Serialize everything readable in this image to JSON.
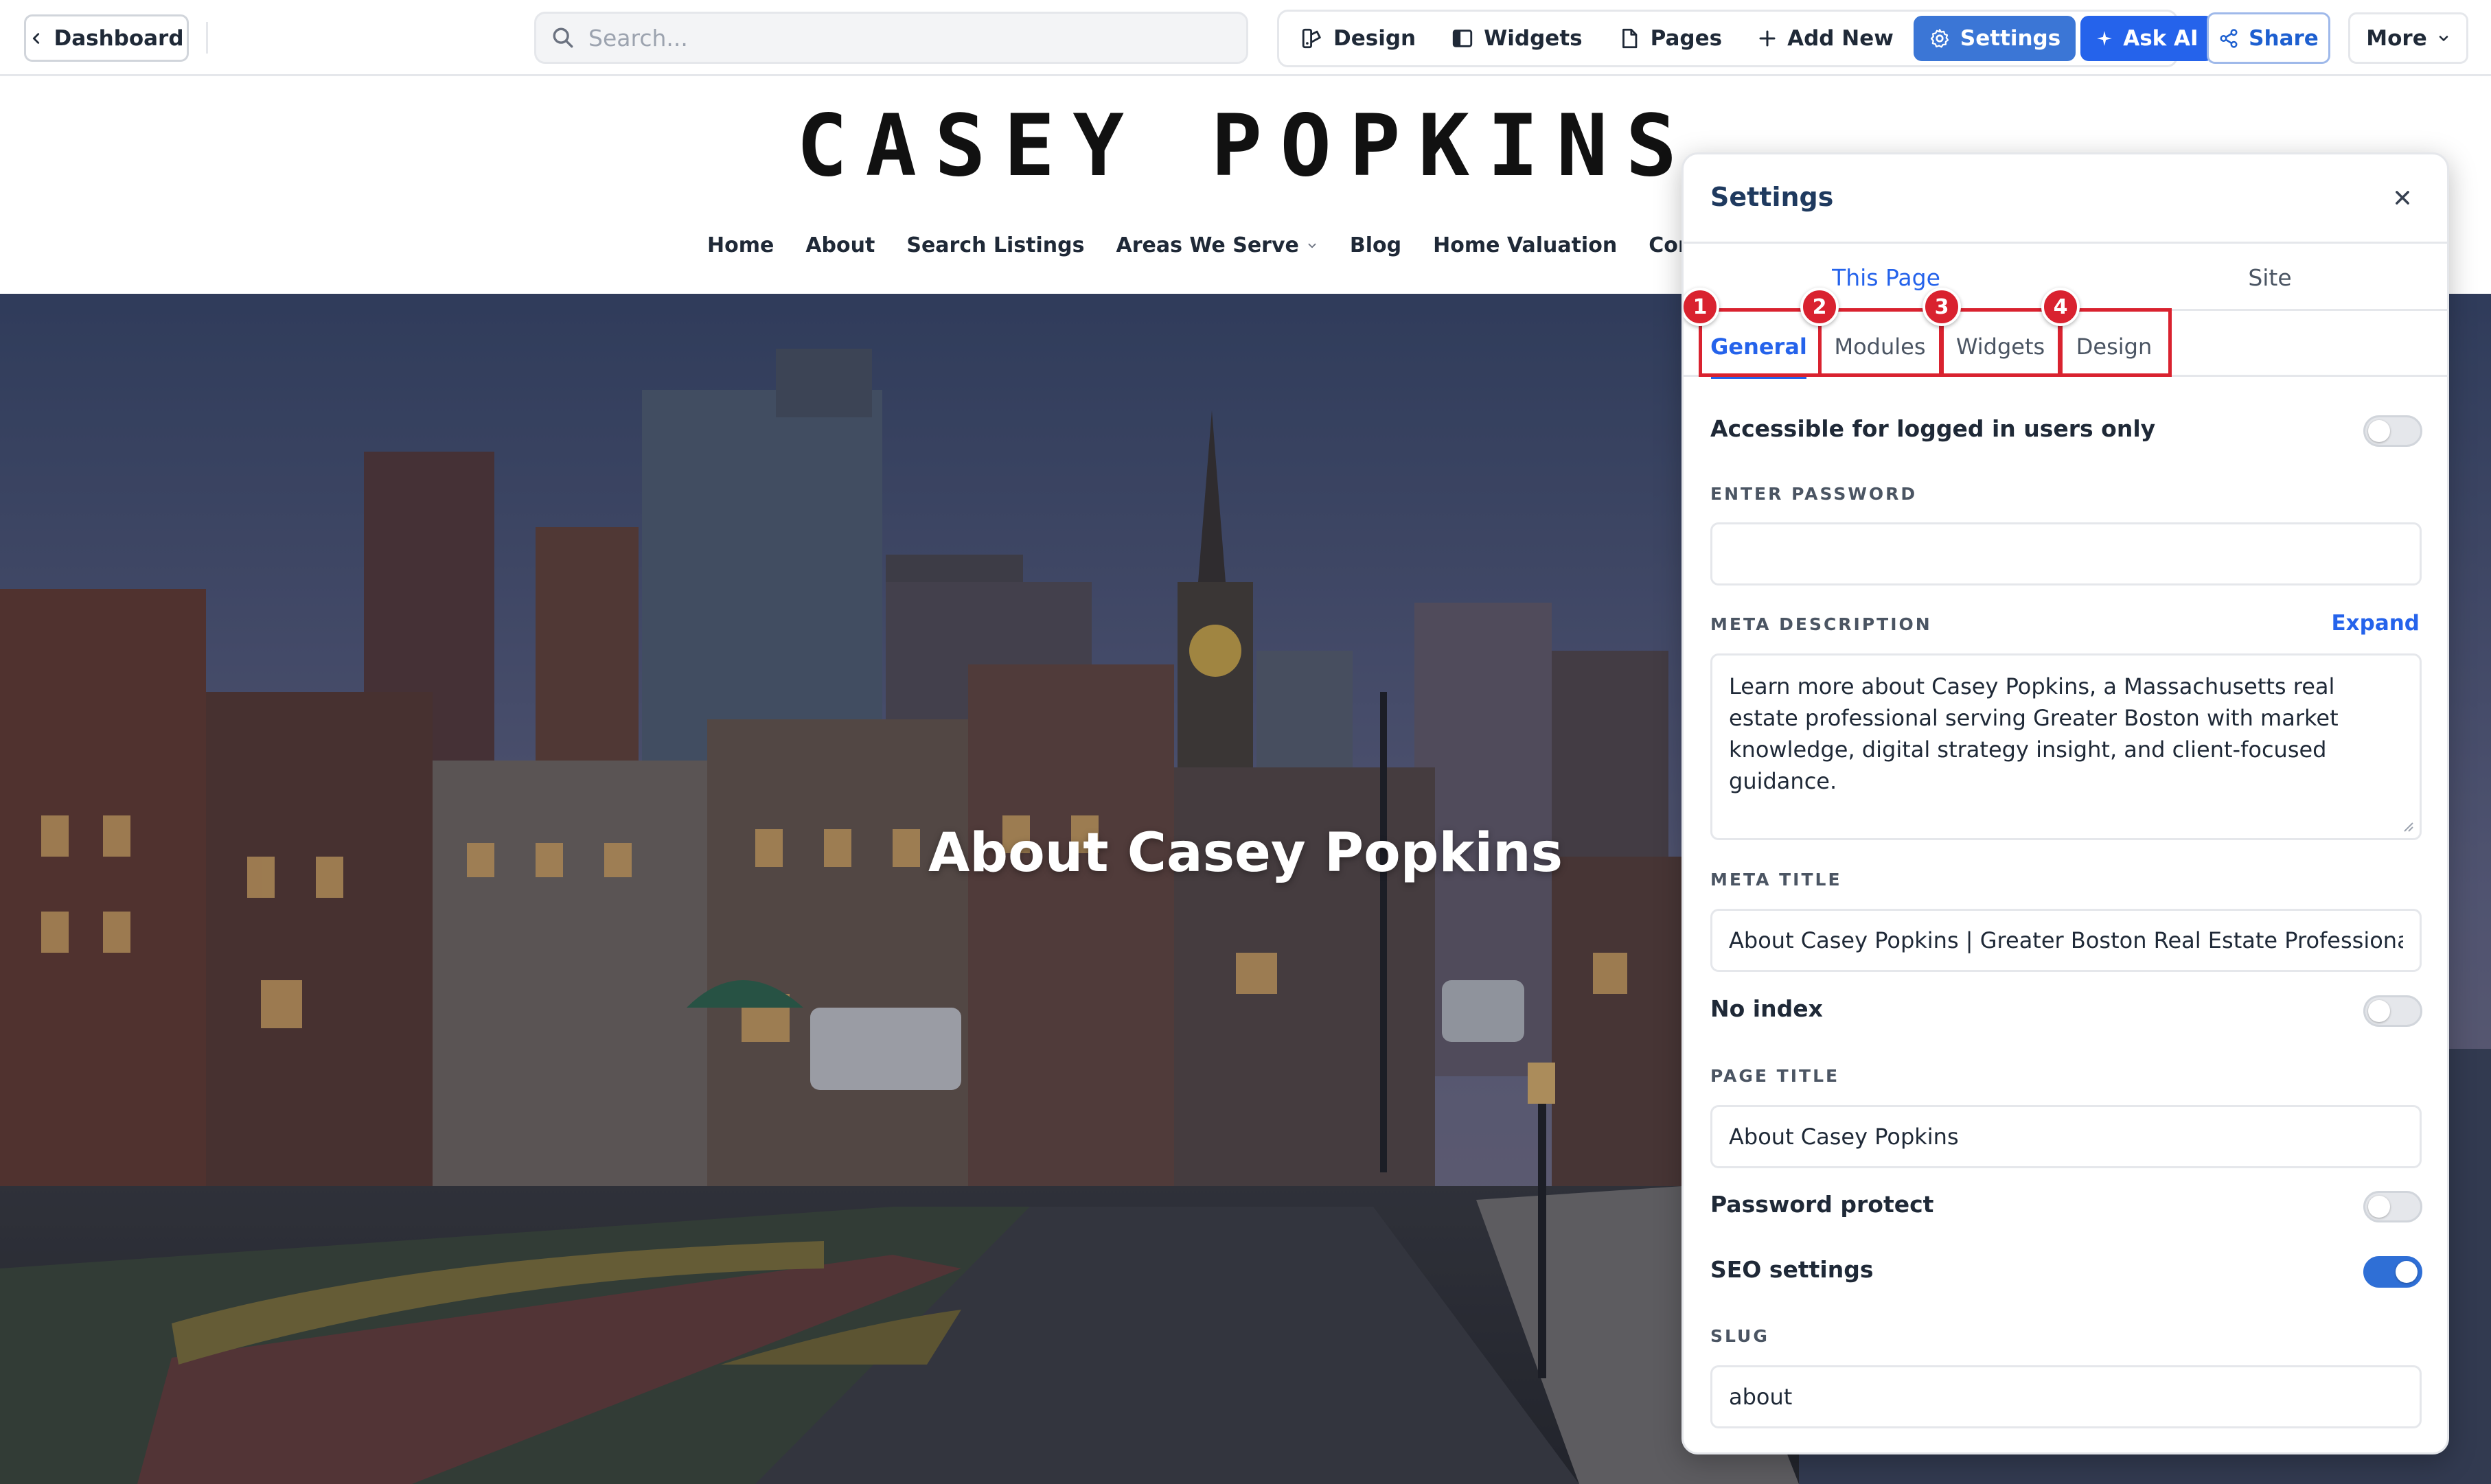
{
  "toolbar": {
    "dashboard_label": "Dashboard",
    "search_placeholder": "Search...",
    "tools": {
      "design": "Design",
      "widgets": "Widgets",
      "pages": "Pages",
      "add_new": "Add New",
      "settings": "Settings",
      "ask_ai": "Ask AI"
    },
    "share_label": "Share",
    "more_label": "More"
  },
  "site": {
    "title": "CASEY POPKINS",
    "nav": [
      "Home",
      "About",
      "Search Listings",
      "Areas We Serve",
      "Blog",
      "Home Valuation",
      "Contact"
    ],
    "hero_title": "About Casey Popkins"
  },
  "settings_panel": {
    "title": "Settings",
    "scope_tabs": [
      "This Page",
      "Site"
    ],
    "active_scope": "This Page",
    "sub_tabs": [
      "General",
      "Modules",
      "Widgets",
      "Design"
    ],
    "active_sub_tab": "General",
    "badges": [
      "1",
      "2",
      "3",
      "4"
    ],
    "fields": {
      "logged_in_only": {
        "label": "Accessible for logged in users only",
        "on": false
      },
      "password": {
        "label": "ENTER PASSWORD",
        "value": ""
      },
      "meta_description": {
        "label": "META DESCRIPTION",
        "expand_label": "Expand",
        "value": "Learn more about Casey Popkins, a Massachusetts real estate professional serving Greater Boston with market knowledge, digital strategy insight, and client-focused guidance."
      },
      "meta_title": {
        "label": "META TITLE",
        "value": "About Casey Popkins | Greater Boston Real Estate Professional"
      },
      "no_index": {
        "label": "No index",
        "on": false
      },
      "page_title": {
        "label": "PAGE TITLE",
        "value": "About Casey Popkins"
      },
      "password_protect": {
        "label": "Password protect",
        "on": false
      },
      "seo_settings": {
        "label": "SEO settings",
        "on": true
      },
      "slug": {
        "label": "SLUG",
        "value": "about"
      }
    }
  },
  "colors": {
    "accent": "#2563eb",
    "highlight": "#d9222f"
  }
}
